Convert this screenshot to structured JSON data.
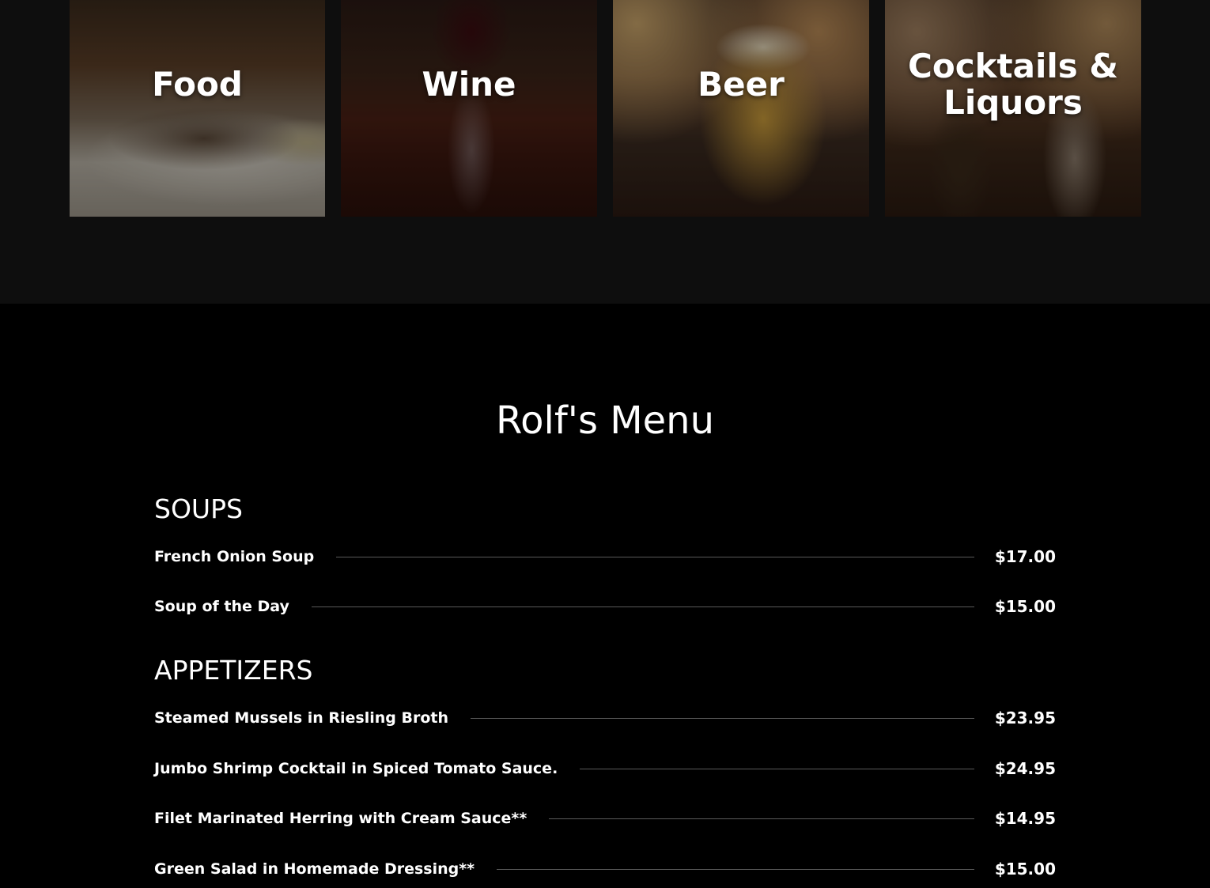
{
  "categories": [
    {
      "label": "Food"
    },
    {
      "label": "Wine"
    },
    {
      "label": "Beer"
    },
    {
      "label": "Cocktails & Liquors"
    }
  ],
  "menu": {
    "title": "Rolf's Menu",
    "sections": [
      {
        "heading": "SOUPS",
        "items": [
          {
            "name": "French Onion Soup",
            "price": "$17.00"
          },
          {
            "name": "Soup of the Day",
            "price": "$15.00"
          }
        ]
      },
      {
        "heading": "APPETIZERS",
        "items": [
          {
            "name": "Steamed Mussels in Riesling Broth",
            "price": "$23.95"
          },
          {
            "name": "Jumbo Shrimp Cocktail in Spiced Tomato Sauce.",
            "price": "$24.95"
          },
          {
            "name": "Filet Marinated Herring with Cream Sauce**",
            "price": "$14.95"
          },
          {
            "name": "Green Salad in Homemade Dressing**",
            "price": "$15.00"
          }
        ]
      }
    ]
  },
  "colors": {
    "page_background": "#000000",
    "category_band_background": "#0e0e0e",
    "text": "#ffffff",
    "leader_line": "#5a5a5a"
  }
}
